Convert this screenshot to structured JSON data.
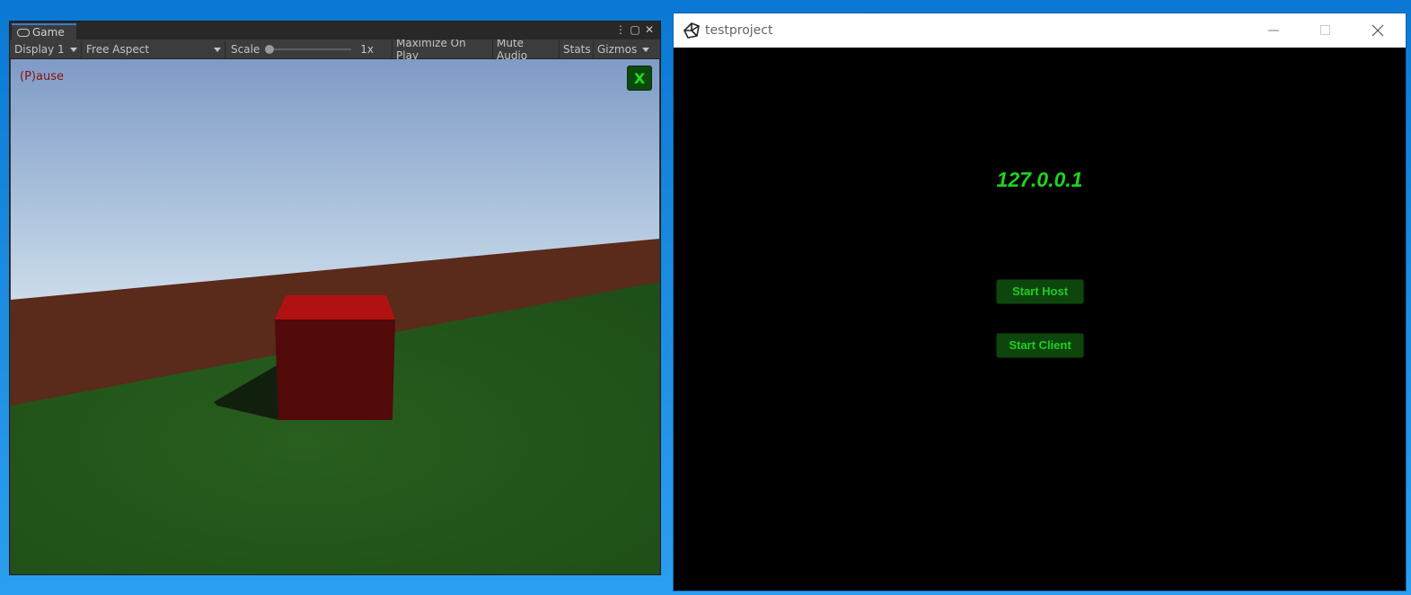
{
  "unity_editor": {
    "tab_label": "Game",
    "toolbar": {
      "display_select": "Display 1",
      "aspect_select": "Free Aspect",
      "scale_label": "Scale",
      "scale_value": "1x",
      "scale_level": 0.0,
      "maximize_on_play": "Maximize On Play",
      "mute_audio": "Mute Audio",
      "stats": "Stats",
      "gizmos": "Gizmos"
    },
    "viewport": {
      "pause_text": "(P)ause",
      "close_button_label": "X"
    },
    "colors": {
      "panel_bg": "#383838",
      "tab_accent": "#3a7bd5",
      "cube_top": "#b01212",
      "cube_front": "#520909",
      "ground": "#23571a",
      "wall": "#4a2518",
      "pause_text": "#8b1010",
      "button_green": "#0b4a0b"
    }
  },
  "game_window": {
    "title": "testproject",
    "ip_address": "127.0.0.1",
    "start_host_label": "Start Host",
    "start_client_label": "Start Client",
    "colors": {
      "background": "#000000",
      "text_green": "#1ed31e",
      "button_bg": "#0c460c"
    }
  }
}
